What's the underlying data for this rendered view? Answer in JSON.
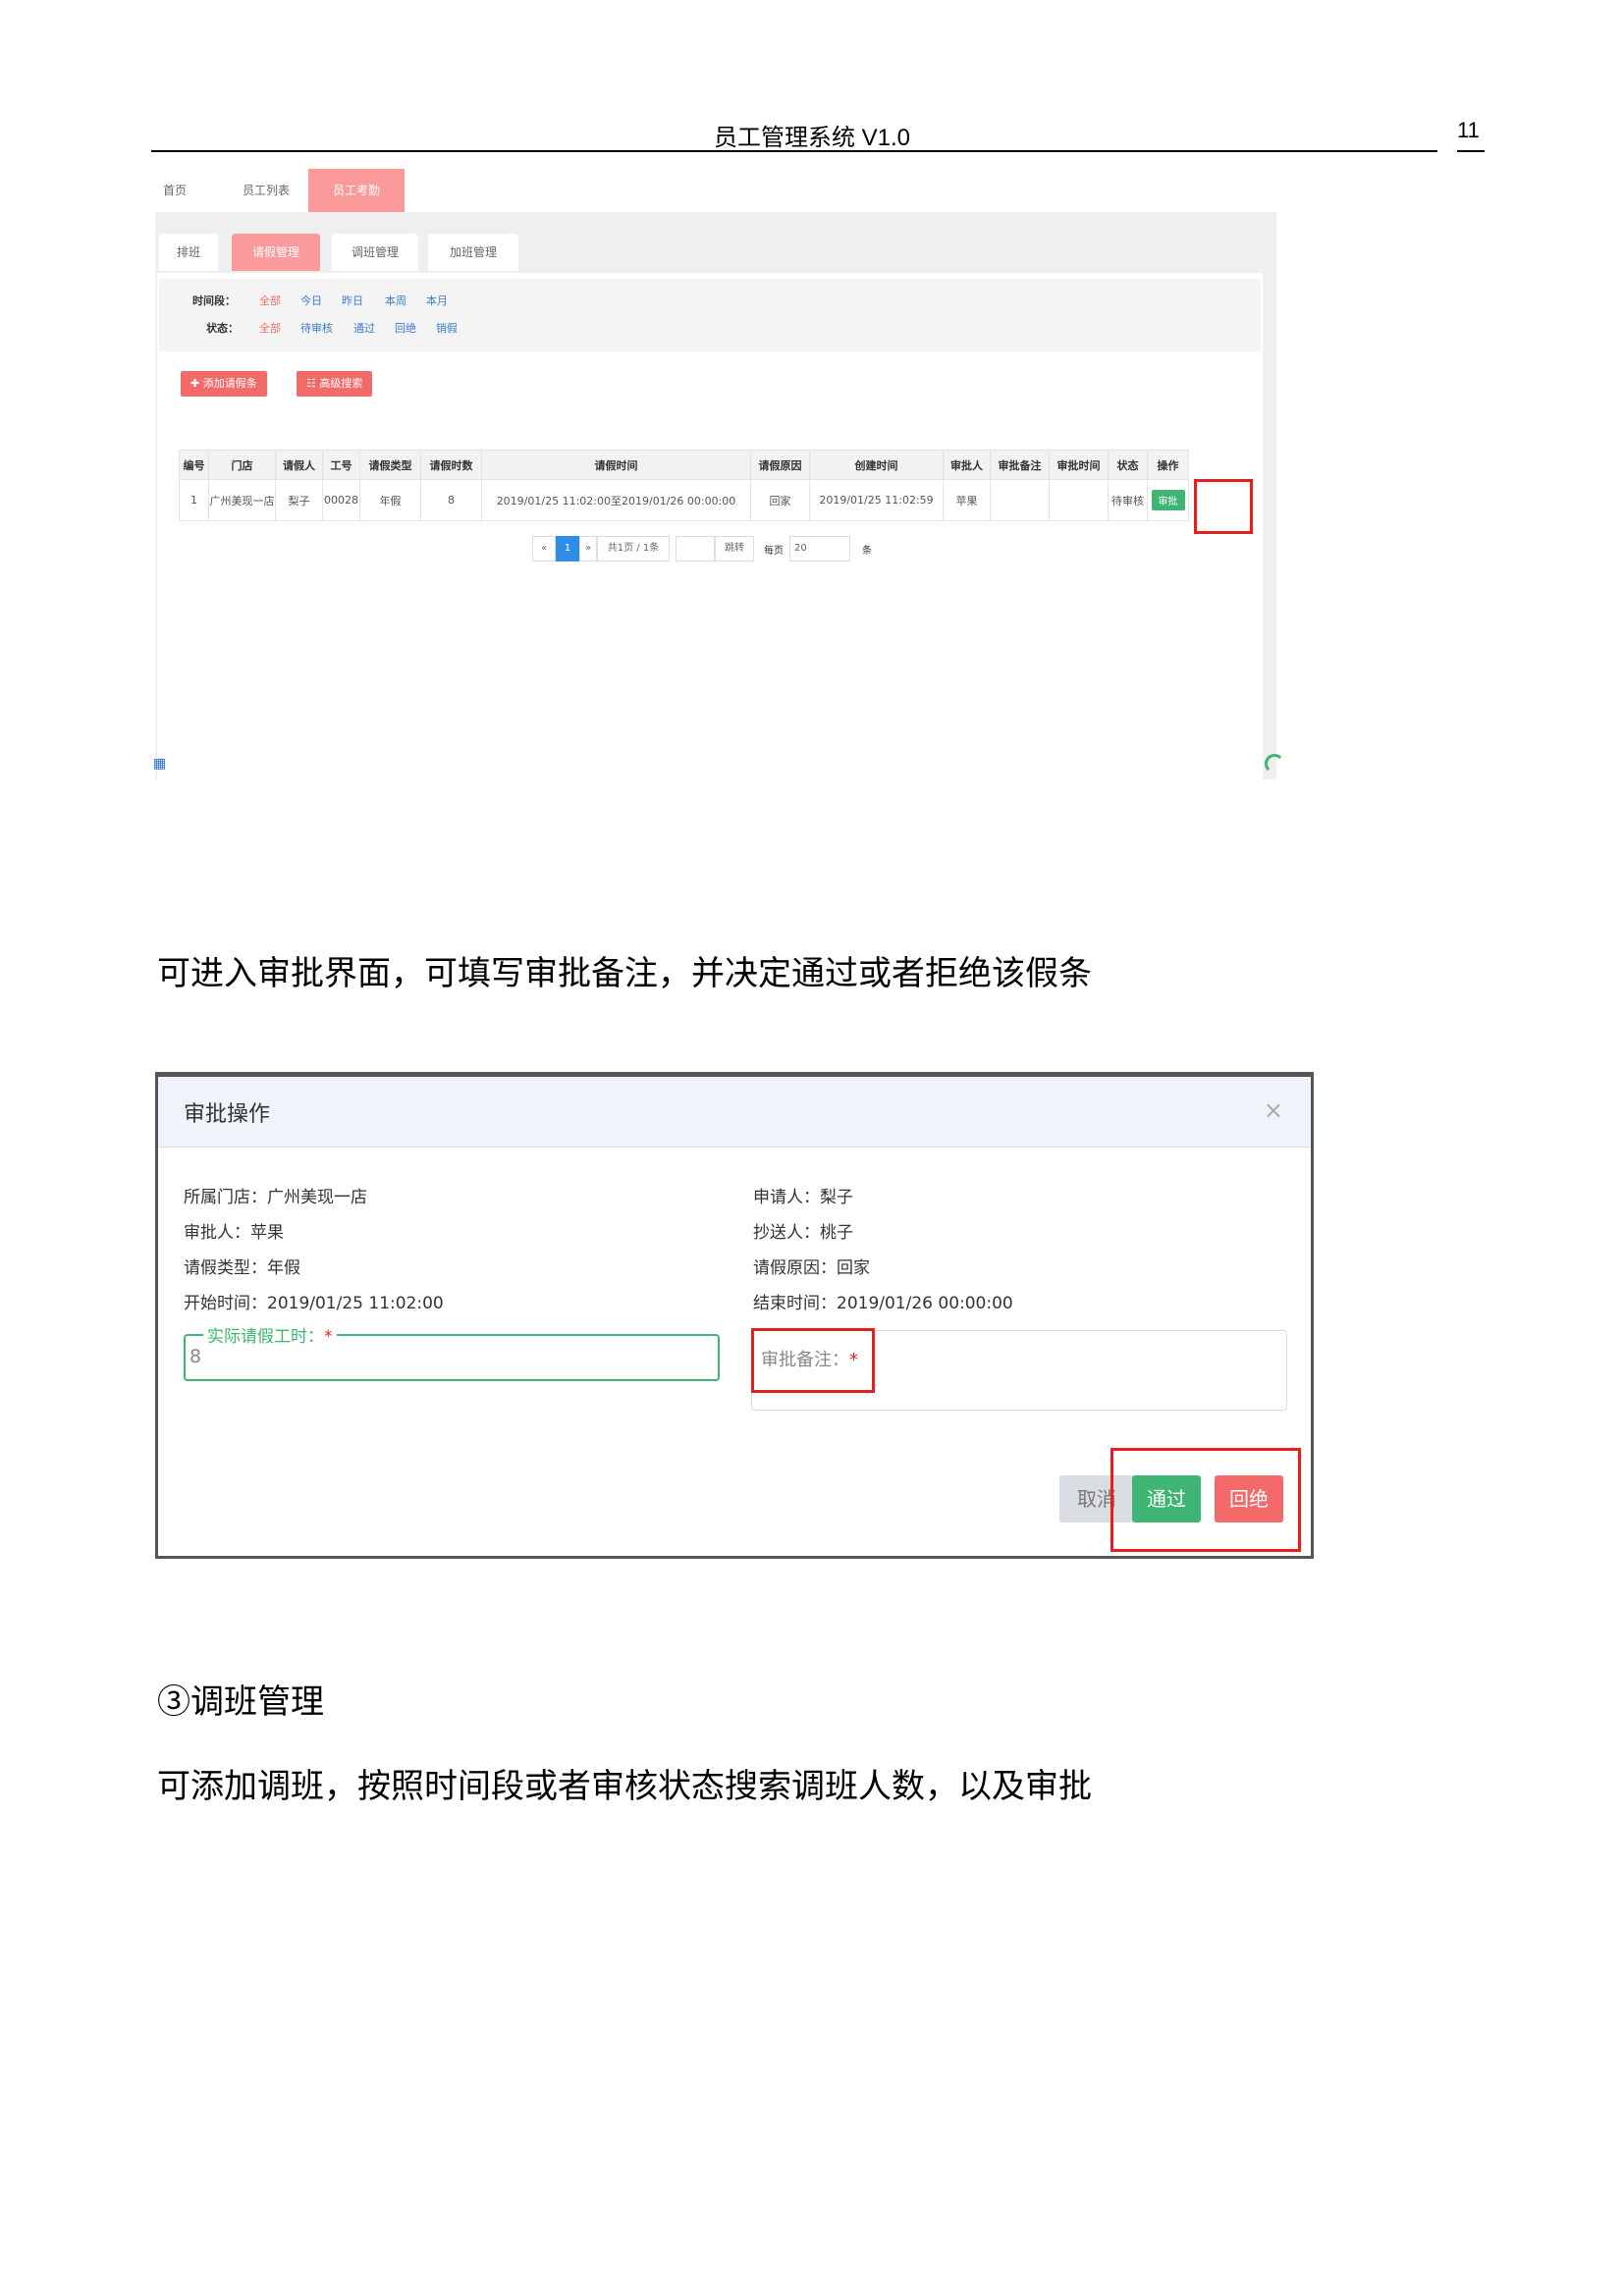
{
  "page_header": {
    "title": "员工管理系统 V1.0",
    "page_number": "11"
  },
  "shot1": {
    "top_tabs": [
      "首页",
      "员工列表",
      "员工考勤"
    ],
    "sub_tabs": [
      "排班",
      "请假管理",
      "调班管理",
      "加班管理"
    ],
    "filters": {
      "period_label": "时间段：",
      "period_options": [
        "全部",
        "今日",
        "昨日",
        "本周",
        "本月"
      ],
      "status_label": "状态：",
      "status_options": [
        "全部",
        "待审核",
        "通过",
        "回绝",
        "销假"
      ]
    },
    "add_button": "✚ 添加请假条",
    "search_button": "☷ 高级搜索",
    "table": {
      "headers": [
        "编号",
        "门店",
        "请假人",
        "工号",
        "请假类型",
        "请假时数",
        "请假时间",
        "请假原因",
        "创建时间",
        "审批人",
        "审批备注",
        "审批时间",
        "状态",
        "操作"
      ],
      "row": [
        "1",
        "广州美现一店",
        "梨子",
        "00028",
        "年假",
        "8",
        "2019/01/25 11:02:00至2019/01/26 00:00:00",
        "回家",
        "2019/01/25 11:02:59",
        "苹果",
        "",
        "",
        "待审核"
      ],
      "action": "审批"
    },
    "pager": {
      "prev": "«",
      "current": "1",
      "next": "»",
      "summary": "共1页 / 1条",
      "jump": "跳转",
      "per_page": "每页",
      "per_page_value": "20",
      "unit": "条"
    }
  },
  "para1": "可进入审批界面，可填写审批备注，并决定通过或者拒绝该假条",
  "modal": {
    "title": "审批操作",
    "close": "×",
    "left_info": [
      "所属门店：广州美现一店",
      "审批人：苹果",
      "请假类型：年假",
      "开始时间：2019/01/25 11:02:00"
    ],
    "right_info": [
      "申请人：梨子",
      "抄送人：桃子",
      "请假原因：回家",
      "结束时间：2019/01/26 00:00:00"
    ],
    "hours_label": "实际请假工时：",
    "hours_value": "8",
    "remark_label": "审批备注：",
    "required_mark": "*",
    "cancel": "取消",
    "pass": "通过",
    "reject": "回绝"
  },
  "section_title": "③调班管理",
  "para2": "可添加调班，按照时间段或者审核状态搜索调班人数，以及审批",
  "colors": {
    "pink": "#fa9a9a",
    "green": "#3fb573",
    "red": "#f36a6a",
    "highlight": "#e61e1e"
  }
}
